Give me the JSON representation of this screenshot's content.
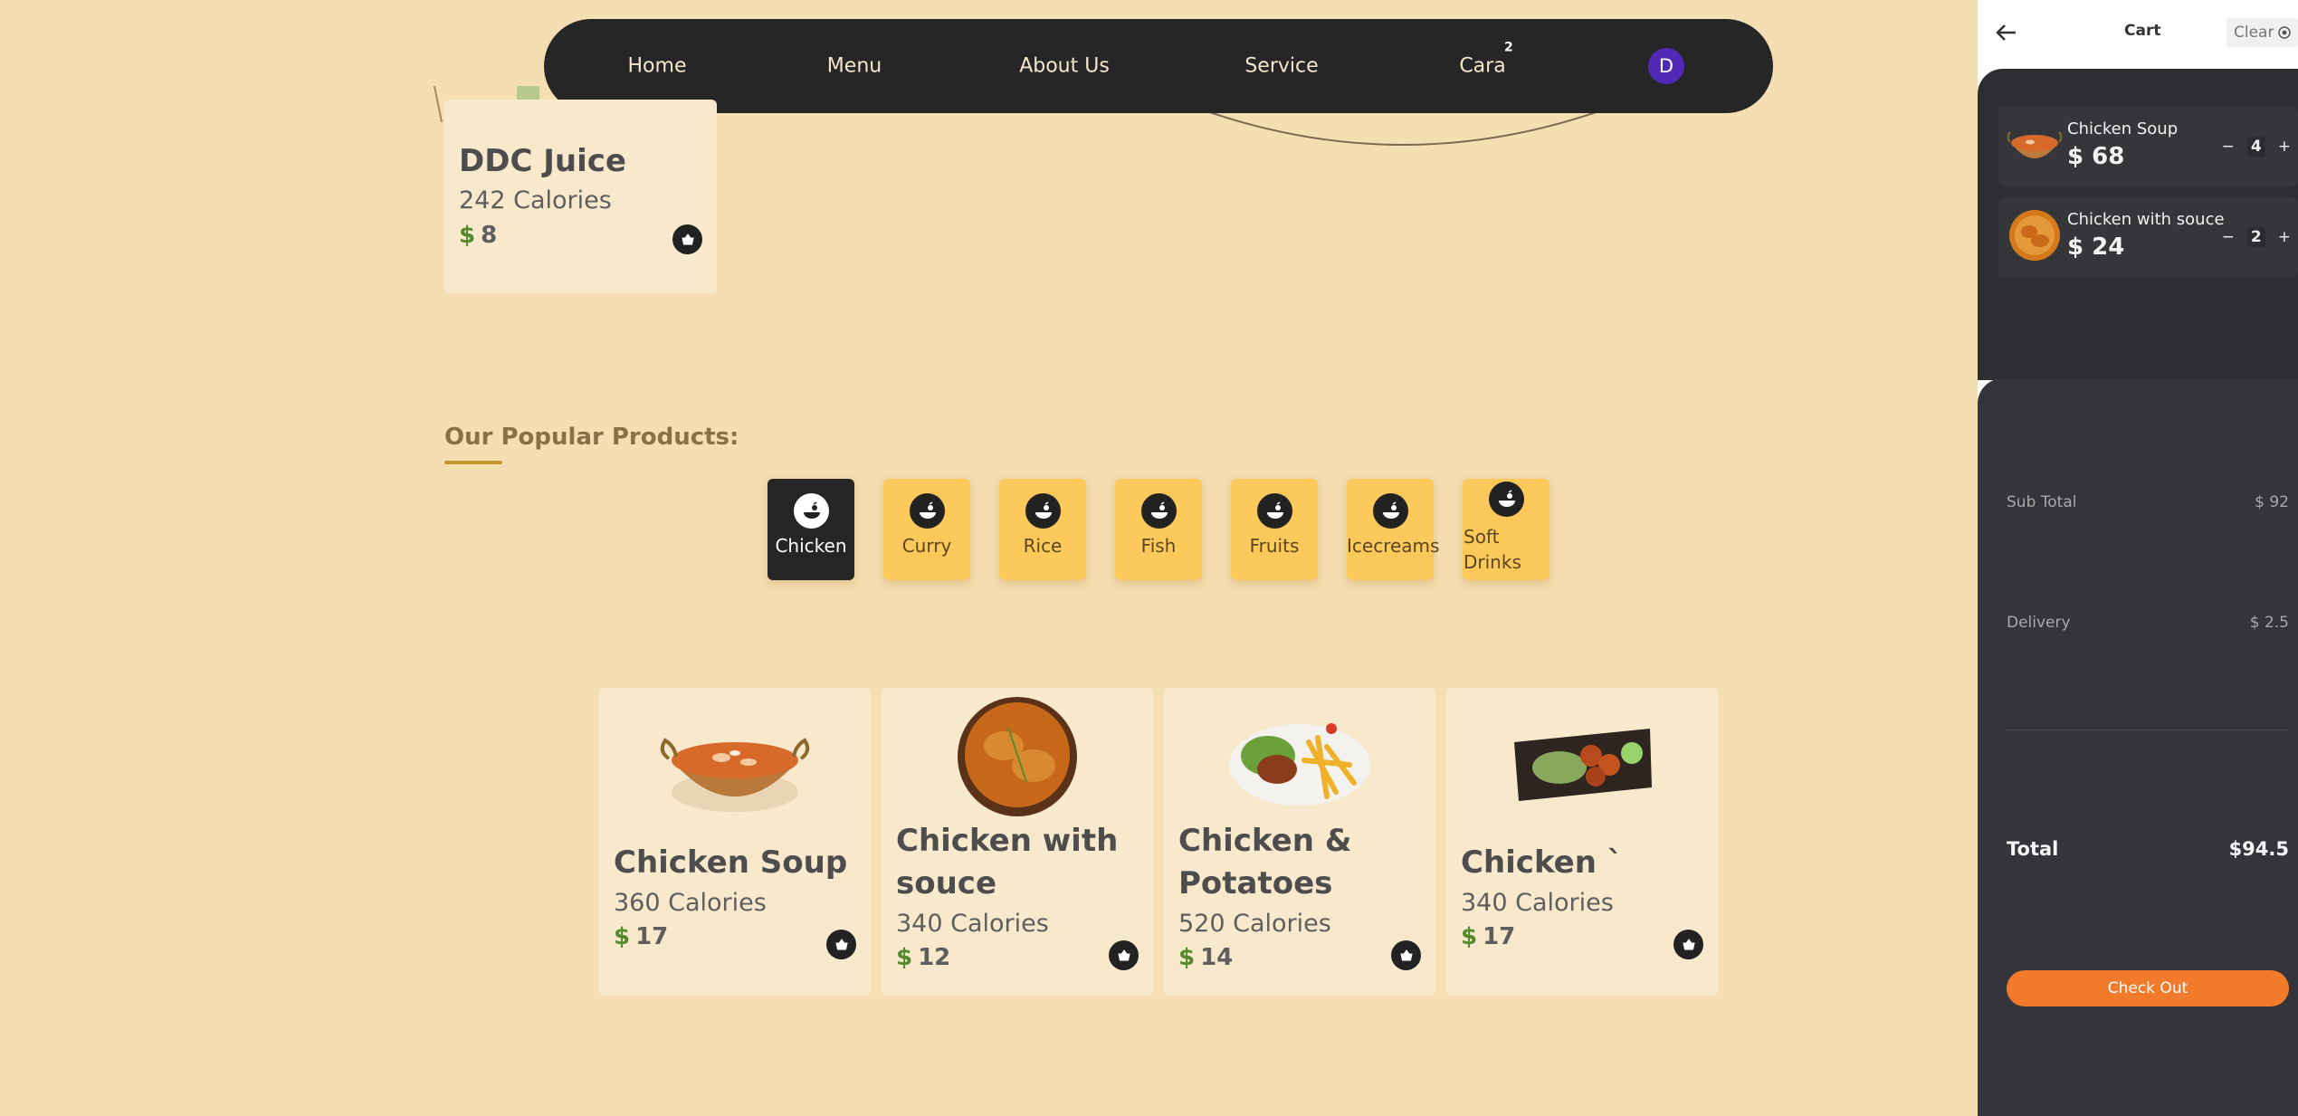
{
  "nav": {
    "items": [
      "Home",
      "Menu",
      "About Us",
      "Service",
      "Cara"
    ],
    "cart_badge": "2",
    "avatar_initial": "D"
  },
  "top_card": {
    "title": "DDC Juice",
    "calories": "242 Calories",
    "currency": "$",
    "price": "8"
  },
  "popular": {
    "title": "Our Popular Products:",
    "categories": [
      "Chicken",
      "Curry",
      "Rice",
      "Fish",
      "Fruits",
      "Icecreams",
      "Soft Drinks"
    ],
    "active_category": "Chicken"
  },
  "products": [
    {
      "title": "Chicken Soup",
      "calories": "360 Calories",
      "currency": "$",
      "price": "17"
    },
    {
      "title": "Chicken with souce",
      "calories": "340 Calories",
      "currency": "$",
      "price": "12"
    },
    {
      "title": "Chicken & Potatoes",
      "calories": "520 Calories",
      "currency": "$",
      "price": "14"
    },
    {
      "title": "Chicken `",
      "calories": "340 Calories",
      "currency": "$",
      "price": "17"
    }
  ],
  "cart": {
    "title": "Cart",
    "clear_label": "Clear",
    "items": [
      {
        "name": "Chicken Soup",
        "price": "$ 68",
        "qty": "4"
      },
      {
        "name": "Chicken with souce",
        "price": "$ 24",
        "qty": "2"
      }
    ],
    "minus": "−",
    "plus": "+",
    "subtotal_label": "Sub Total",
    "subtotal_value": "$ 92",
    "delivery_label": "Delivery",
    "delivery_value": "$ 2.5",
    "total_label": "Total",
    "total_value": "$94.5",
    "checkout_label": "Check Out"
  },
  "colors": {
    "page_bg": "#f5deb1",
    "nav_bg": "#262626",
    "category_bg": "#fcc95a",
    "price_green": "#558b2f",
    "checkout_orange": "#f27a2b",
    "avatar_purple": "#4f2ab6"
  }
}
